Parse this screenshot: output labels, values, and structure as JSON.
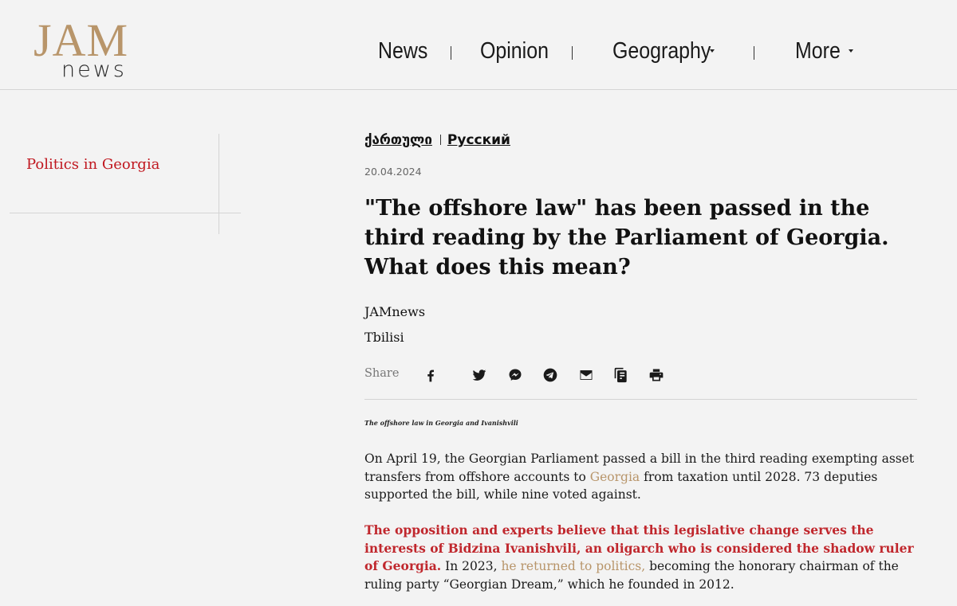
{
  "header": {
    "logo_top": "JAM",
    "logo_bottom": "news",
    "nav": {
      "news": "News",
      "opinion": "Opinion",
      "geography": "Geography",
      "more": "More"
    }
  },
  "sidebar": {
    "link": "Politics in Georgia"
  },
  "article": {
    "languages": [
      "ქართული",
      "Русский"
    ],
    "date": "20.04.2024",
    "title": "\"The offshore law\" has been passed in the third reading by the Parliament of Georgia. What does this mean?",
    "author": "JAMnews",
    "city": "Tbilisi",
    "share_label": "Share",
    "share_icons": [
      "facebook-icon",
      "twitter-icon",
      "messenger-icon",
      "telegram-icon",
      "email-icon",
      "copy-icon",
      "print-icon"
    ],
    "image_caption": "The offshore law in Georgia and Ivanishvili",
    "p1": {
      "text_a": "On April 19, the Georgian Parliament passed a bill in the third reading exempting asset transfers from offshore accounts to ",
      "link": "Georgia",
      "text_b": " from taxation until 2028. 73 deputies supported the bill, while nine voted against."
    },
    "p2": {
      "highlight": "The opposition and experts believe that this legislative change serves the interests of Bidzina Ivanishvili, an oligarch who is considered the shadow ruler of Georgia.",
      "text_a": " In 2023, ",
      "link": "he returned to politics,",
      "text_b": " becoming the honorary chairman of the ruling party “Georgian Dream,” which he founded in 2012."
    }
  },
  "colors": {
    "brand_gold": "#b8956a",
    "accent_red": "#c0171f",
    "background": "#f3f3f3"
  }
}
